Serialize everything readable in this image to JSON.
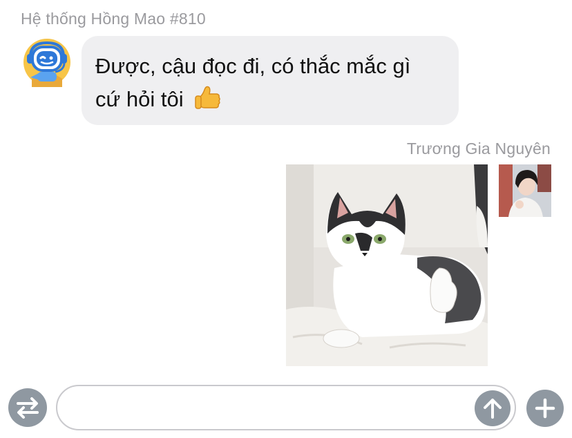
{
  "chat": {
    "incoming": {
      "sender": "Hệ thống Hồng Mao #810",
      "avatar_icon": "robot-headset-icon",
      "message_line1": "Được, cậu đọc đi, có thắc mắc gì",
      "message_line2": "cứ hỏi tôi",
      "emoji": "thumbs-up-icon"
    },
    "outgoing": {
      "sender": "Trương Gia Nguyên",
      "image": "cat-thumbs-up-photo",
      "avatar": "user-avatar-photo"
    }
  },
  "composer": {
    "input_value": "",
    "placeholder": "",
    "left_button_icon": "swap-arrows-icon",
    "send_button_icon": "arrow-up-icon",
    "add_button_icon": "plus-icon"
  },
  "colors": {
    "bubble_bg": "#efeff1",
    "name_text": "#9a9a9e",
    "button_bg": "#8f98a1",
    "input_border": "#c9c9cd"
  }
}
